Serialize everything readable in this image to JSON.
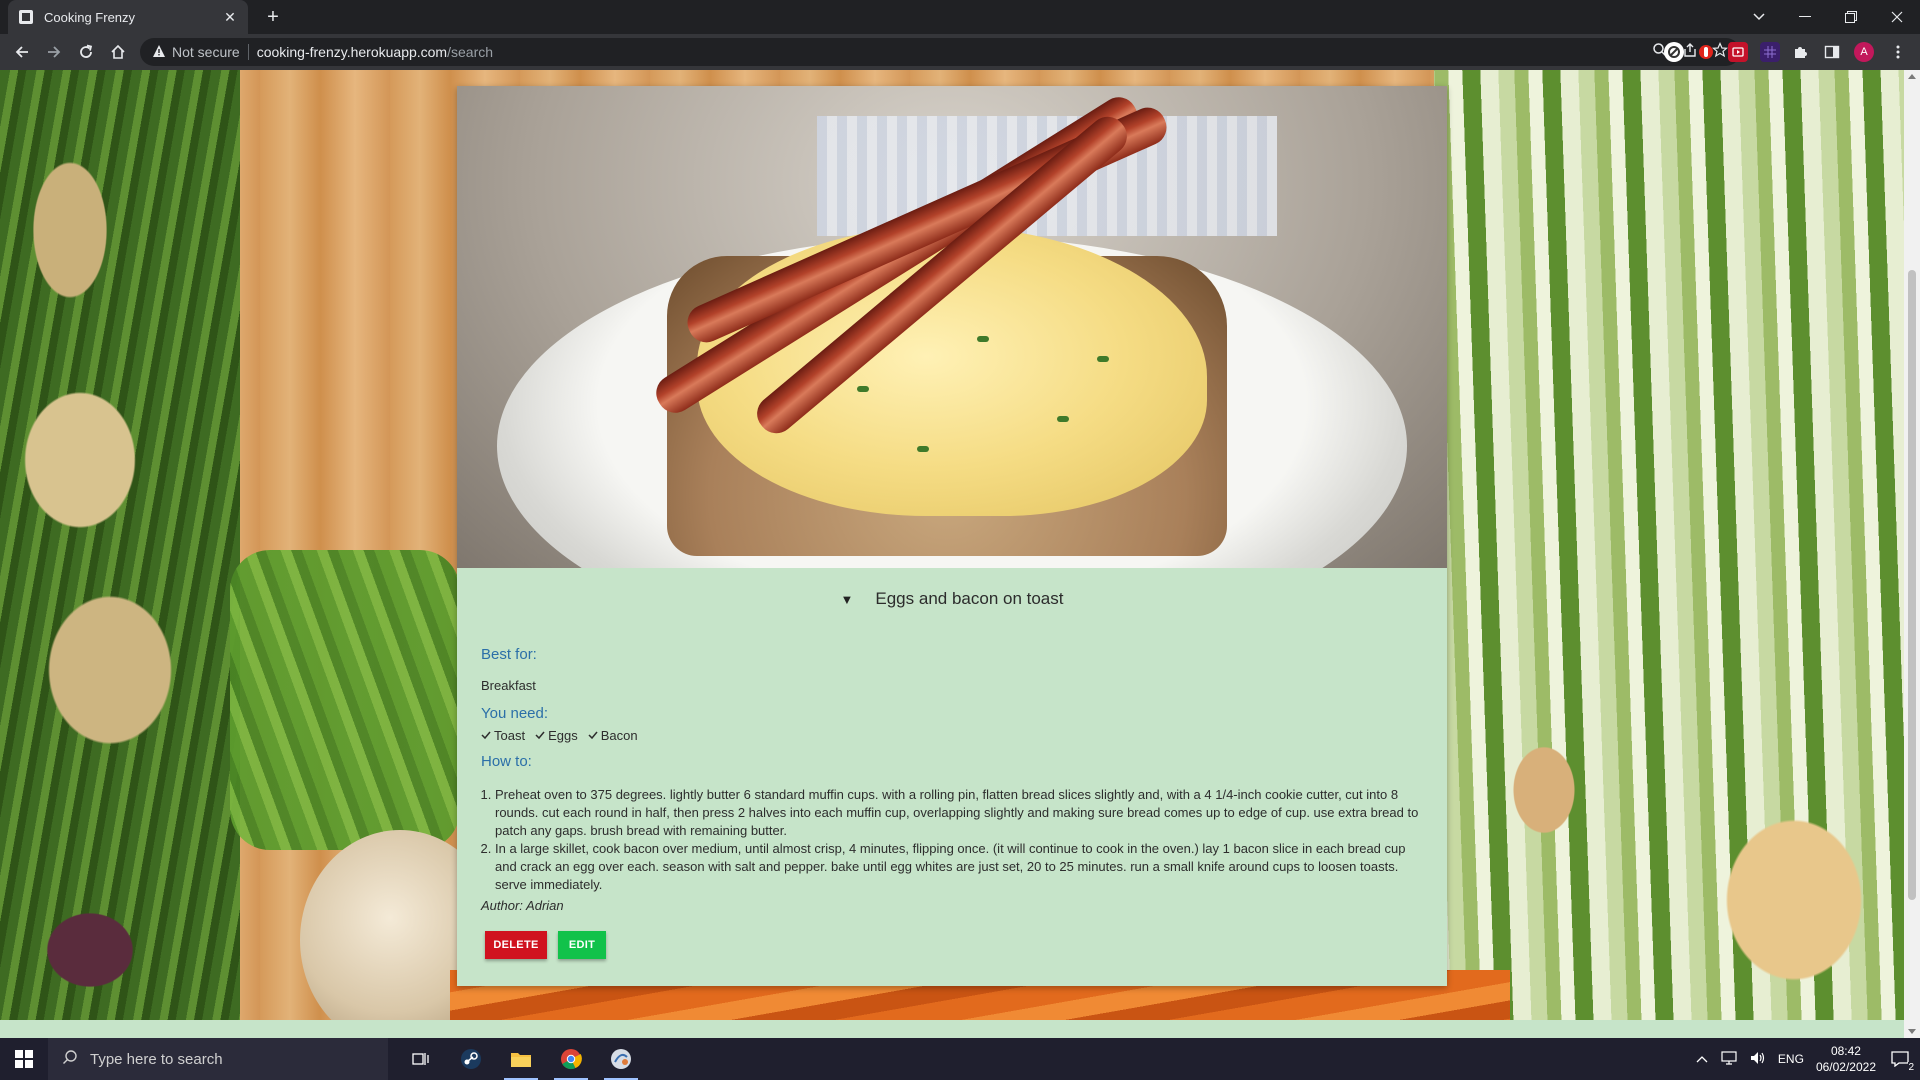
{
  "browser": {
    "tab_title": "Cooking Frenzy",
    "security_label": "Not secure",
    "url_host": "cooking-frenzy.herokuapp.com",
    "url_path": "/search"
  },
  "recipe": {
    "name": "Eggs and bacon on toast",
    "best_for_label": "Best for:",
    "best_for": "Breakfast",
    "you_need_label": "You need:",
    "ingredients": [
      "Toast",
      "Eggs",
      "Bacon"
    ],
    "how_to_label": "How to:",
    "steps": [
      "Preheat oven to 375 degrees. lightly butter 6 standard muffin cups. with a rolling pin, flatten bread slices slightly and, with a 4 1/4-inch cookie cutter, cut into 8 rounds. cut each round in half, then press 2 halves into each muffin cup, overlapping slightly and making sure bread comes up to edge of cup. use extra bread to patch any gaps. brush bread with remaining butter.",
      "In a large skillet, cook bacon over medium, until almost crisp, 4 minutes, flipping once. (it will continue to cook in the oven.) lay 1 bacon slice in each bread cup and crack an egg over each. season with salt and pepper. bake until egg whites are just set, 20 to 25 minutes. run a small knife around cups to loosen toasts. serve immediately."
    ],
    "author": "Author: Adrian",
    "delete_label": "DELETE",
    "edit_label": "EDIT"
  },
  "taskbar": {
    "search_placeholder": "Type here to search",
    "language": "ENG",
    "time": "08:42",
    "date": "06/02/2022",
    "notification_count": "2"
  },
  "colors": {
    "card_bg": "#c6e4c9",
    "label_blue": "#2b6fa8",
    "delete_red": "#d0121f",
    "edit_green": "#11c24a"
  }
}
